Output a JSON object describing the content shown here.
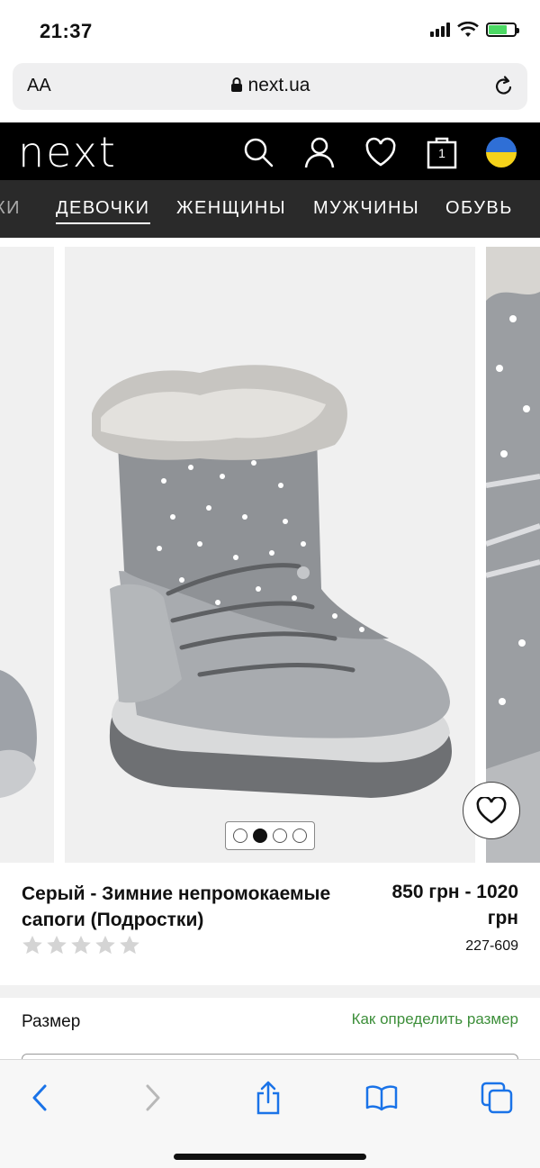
{
  "status": {
    "time": "21:37"
  },
  "browser": {
    "text_size": "AA",
    "url": "next.ua"
  },
  "header": {
    "logo": "next",
    "bag_count": "1"
  },
  "nav": {
    "partial_left": "КИ",
    "items": [
      "ДЕВОЧКИ",
      "ЖЕНЩИНЫ",
      "МУЖЧИНЫ",
      "ОБУВЬ"
    ]
  },
  "gallery": {
    "slides": 4,
    "active_slide": 2
  },
  "product": {
    "title": "Серый - Зимние непромокаемые сапоги (Подростки)",
    "price": "850 грн - 1020 грн",
    "rating": 0,
    "rating_max": 5,
    "sku": "227-609"
  },
  "size": {
    "label": "Размер",
    "guide_link": "Как определить размер"
  },
  "colors": {
    "accent_green": "#3d8f3a",
    "header_bg": "#000000",
    "nav_bg": "#2a2a2a"
  }
}
